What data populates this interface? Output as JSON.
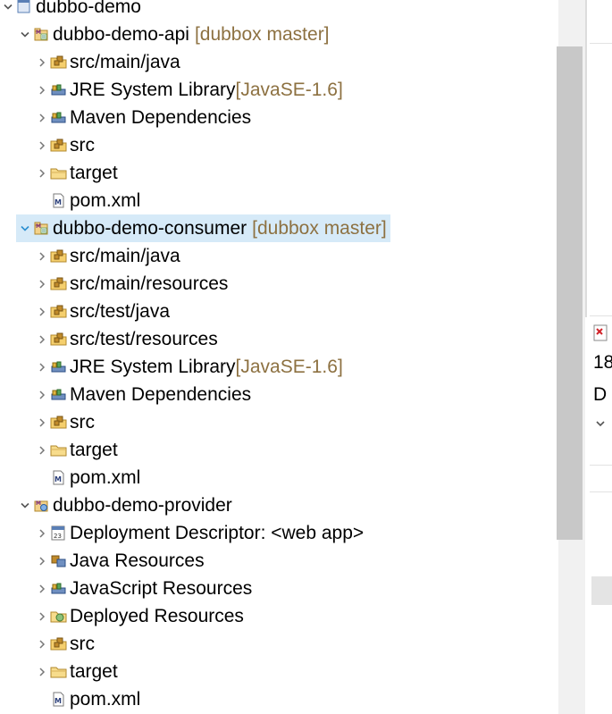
{
  "tree": {
    "rows": [
      {
        "label": "dubbo-demo",
        "decoration": "",
        "state": "expanded",
        "icon": "working-set-icon",
        "depth": 0
      },
      {
        "label": "dubbo-demo-api",
        "decoration": "[dubbox master]",
        "state": "expanded",
        "icon": "maven-project-icon",
        "depth": 1
      },
      {
        "label": "src/main/java",
        "decoration": "",
        "state": "collapsed",
        "icon": "source-folder-icon",
        "depth": 2
      },
      {
        "label": "JRE System Library ",
        "decoration": "[JavaSE-1.6]",
        "state": "collapsed",
        "icon": "library-icon",
        "depth": 2
      },
      {
        "label": "Maven Dependencies",
        "decoration": "",
        "state": "collapsed",
        "icon": "library-icon",
        "depth": 2
      },
      {
        "label": "src",
        "decoration": "",
        "state": "collapsed",
        "icon": "source-folder-icon",
        "depth": 2
      },
      {
        "label": "target",
        "decoration": "",
        "state": "collapsed",
        "icon": "folder-icon",
        "depth": 2
      },
      {
        "label": "pom.xml",
        "decoration": "",
        "state": "leaf",
        "icon": "maven-pom-icon",
        "depth": 2
      },
      {
        "label": "dubbo-demo-consumer",
        "decoration": "[dubbox master]",
        "state": "expanded",
        "icon": "maven-project-icon",
        "depth": 1,
        "selected": true
      },
      {
        "label": "src/main/java",
        "decoration": "",
        "state": "collapsed",
        "icon": "source-folder-icon",
        "depth": 2
      },
      {
        "label": "src/main/resources",
        "decoration": "",
        "state": "collapsed",
        "icon": "source-folder-icon",
        "depth": 2
      },
      {
        "label": "src/test/java",
        "decoration": "",
        "state": "collapsed",
        "icon": "source-folder-icon",
        "depth": 2
      },
      {
        "label": "src/test/resources",
        "decoration": "",
        "state": "collapsed",
        "icon": "source-folder-icon",
        "depth": 2
      },
      {
        "label": "JRE System Library ",
        "decoration": "[JavaSE-1.6]",
        "state": "collapsed",
        "icon": "library-icon",
        "depth": 2
      },
      {
        "label": "Maven Dependencies",
        "decoration": "",
        "state": "collapsed",
        "icon": "library-icon",
        "depth": 2
      },
      {
        "label": "src",
        "decoration": "",
        "state": "collapsed",
        "icon": "source-folder-icon",
        "depth": 2
      },
      {
        "label": "target",
        "decoration": "",
        "state": "collapsed",
        "icon": "folder-icon",
        "depth": 2
      },
      {
        "label": "pom.xml",
        "decoration": "",
        "state": "leaf",
        "icon": "maven-pom-icon",
        "depth": 2
      },
      {
        "label": "dubbo-demo-provider",
        "decoration": "",
        "state": "expanded",
        "icon": "web-project-icon",
        "depth": 1
      },
      {
        "label": "Deployment Descriptor: <web app>",
        "decoration": "",
        "state": "collapsed",
        "icon": "deployment-descriptor-icon",
        "depth": 2
      },
      {
        "label": "Java Resources",
        "decoration": "",
        "state": "collapsed",
        "icon": "java-resources-icon",
        "depth": 2
      },
      {
        "label": "JavaScript Resources",
        "decoration": "",
        "state": "collapsed",
        "icon": "library-icon",
        "depth": 2
      },
      {
        "label": "Deployed Resources",
        "decoration": "",
        "state": "collapsed",
        "icon": "deployed-resources-icon",
        "depth": 2
      },
      {
        "label": "src",
        "decoration": "",
        "state": "collapsed",
        "icon": "source-folder-icon",
        "depth": 2
      },
      {
        "label": "target",
        "decoration": "",
        "state": "collapsed",
        "icon": "folder-icon",
        "depth": 2
      },
      {
        "label": "pom.xml",
        "decoration": "",
        "state": "leaf",
        "icon": "maven-pom-icon",
        "depth": 2
      }
    ]
  },
  "right_panel": {
    "text1": "18",
    "text2": "D",
    "icon": "error-marker-icon",
    "chevron": "chevron-down-icon"
  },
  "colors": {
    "decoration": "#8d7141",
    "selection": "#d6eaf8",
    "twistie": "#555555"
  }
}
